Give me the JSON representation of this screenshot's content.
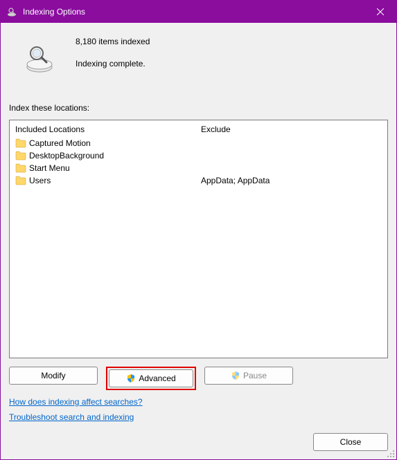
{
  "titlebar": {
    "title": "Indexing Options"
  },
  "status": {
    "items_indexed": "8,180 items indexed",
    "state": "Indexing complete."
  },
  "locations": {
    "label": "Index these locations:",
    "headers": {
      "included": "Included Locations",
      "exclude": "Exclude"
    },
    "rows": [
      {
        "name": "Captured Motion",
        "exclude": ""
      },
      {
        "name": "DesktopBackground",
        "exclude": ""
      },
      {
        "name": "Start Menu",
        "exclude": ""
      },
      {
        "name": "Users",
        "exclude": "AppData; AppData"
      }
    ]
  },
  "buttons": {
    "modify": "Modify",
    "advanced": "Advanced",
    "pause": "Pause",
    "close": "Close"
  },
  "links": {
    "how": "How does indexing affect searches?",
    "troubleshoot": "Troubleshoot search and indexing"
  }
}
